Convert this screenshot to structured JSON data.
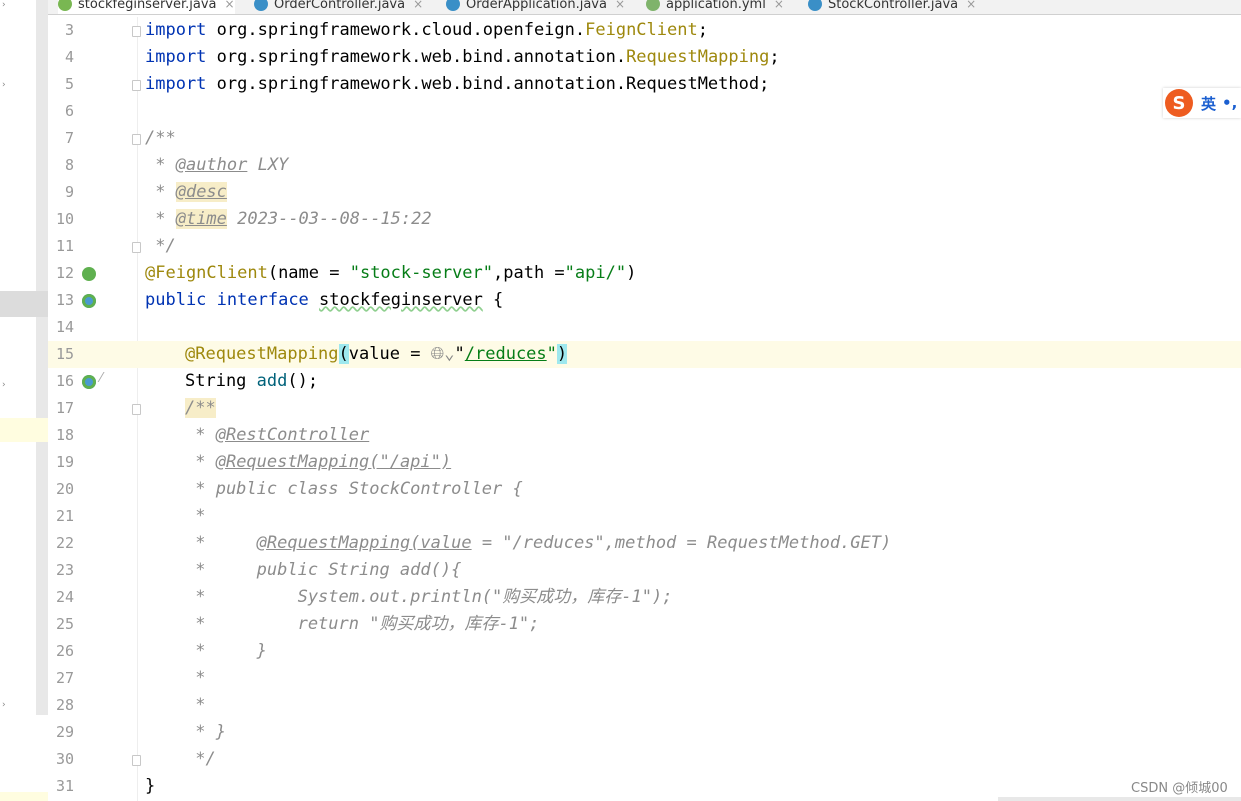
{
  "tabs": [
    {
      "label": "stockfeginserver.java",
      "icon_color": "#79b752",
      "active": true
    },
    {
      "label": "OrderController.java",
      "icon_color": "#3a8fc7",
      "active": false
    },
    {
      "label": "OrderApplication.java",
      "icon_color": "#3a8fc7",
      "active": false
    },
    {
      "label": "application.yml",
      "icon_color": "#7fb36b",
      "active": false
    },
    {
      "label": "StockController.java",
      "icon_color": "#3a8fc7",
      "active": false
    }
  ],
  "close_glyph": "×",
  "line_numbers": [
    "3",
    "4",
    "5",
    "6",
    "7",
    "8",
    "9",
    "10",
    "11",
    "12",
    "13",
    "14",
    "15",
    "16",
    "17",
    "18",
    "19",
    "20",
    "21",
    "22",
    "23",
    "24",
    "25",
    "26",
    "27",
    "28",
    "29",
    "30",
    "31"
  ],
  "code": {
    "l3": {
      "kw": "import",
      "pkg": " org.springframework.cloud.openfeign.",
      "cls": "FeignClient",
      "end": ";"
    },
    "l4": {
      "kw": "import",
      "pkg": " org.springframework.web.bind.annotation.",
      "cls": "RequestMapping",
      "end": ";"
    },
    "l5": {
      "kw": "import",
      "pkg": " org.springframework.web.bind.annotation.RequestMethod;"
    },
    "l7": "/**",
    "l8": {
      "star": " * ",
      "tag": "@author",
      "rest": " LXY"
    },
    "l9": {
      "star": " * ",
      "tag": "@desc"
    },
    "l10": {
      "star": " * ",
      "tag": "@time",
      "rest": " 2023--03--08--15:22"
    },
    "l11": " */",
    "l12": {
      "ann": "@FeignClient",
      "a": "(name = ",
      "s1": "\"stock-server\"",
      "b": ",path =",
      "s2": "\"api/\"",
      "c": ")"
    },
    "l13": {
      "kw1": "public",
      "kw2": "interface",
      "name": "stockfeginserver",
      "end": " {"
    },
    "l15": {
      "ann": "@RequestMapping",
      "open": "(",
      "a": "value = ",
      "globe": "🌐︎⌄",
      "q": "\"",
      "url": "/reduces",
      "q2": "\"",
      "close": ")"
    },
    "l16": {
      "type": "String ",
      "fn": "add",
      "end": "();"
    },
    "l17": "/**",
    "l18": {
      "star": " * ",
      "tag": "@RestController"
    },
    "l19": {
      "star": " * ",
      "tag": "@RequestMapping(\"/api\")"
    },
    "l20": " * public class StockController {",
    "l21": " *",
    "l22": {
      "star": " *     ",
      "tag": "@RequestMapping(value",
      "rest": " = \"/reduces\",method = RequestMethod.GET)"
    },
    "l23": " *     public String add(){",
    "l24": " *         System.out.println(\"购买成功，库存-1\");",
    "l25": " *         return \"购买成功，库存-1\";",
    "l26": " *     }",
    "l27": " *",
    "l28": " *",
    "l29": " * }",
    "l30": " */",
    "l31": "}"
  },
  "ime": {
    "logo": "S",
    "mode": "英",
    "punct": "•,"
  },
  "watermark": "CSDN @倾城00"
}
